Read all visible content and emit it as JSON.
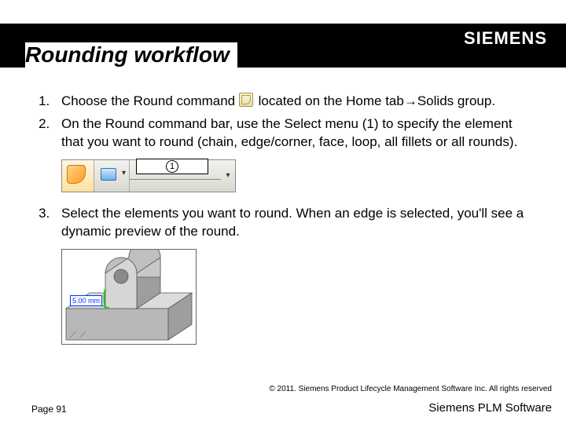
{
  "header": {
    "title": "Rounding workflow",
    "logo_text": "SIEMENS"
  },
  "steps": {
    "s1_pre": "Choose the Round command",
    "s1_post": " located on the Home tab→Solids group.",
    "s2": "On the Round command bar, use the Select menu (1) to specify the element that you want to round (chain, edge/corner, face, loop, all fillets or all rounds).",
    "s3": "Select the elements you want to round. When an edge is selected, you'll see a dynamic preview of the round."
  },
  "cmdbar": {
    "callout_number": "1"
  },
  "preview": {
    "dimension_label": "5.00 mm"
  },
  "footer": {
    "copyright": "© 2011. Siemens Product Lifecycle Management Software Inc. All rights reserved",
    "page": "Page 91",
    "brand": "Siemens PLM Software"
  }
}
